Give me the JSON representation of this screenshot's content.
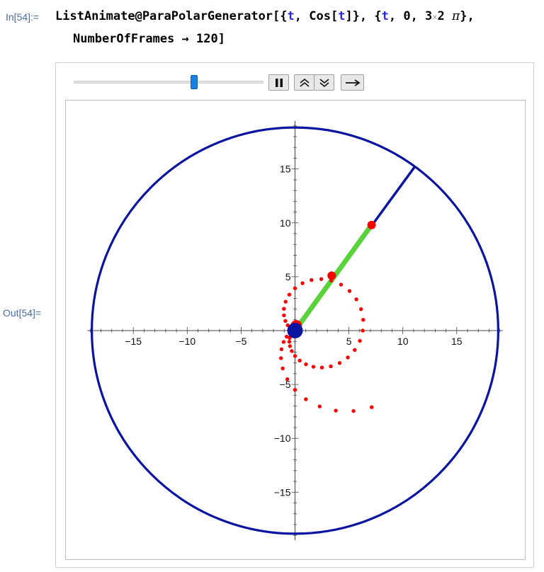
{
  "input": {
    "label": "In[54]:=",
    "line1": {
      "head": "ListAnimate@ParaPolarGenerator[{",
      "var1": "t",
      "mid1": ", Cos[",
      "var2": "t",
      "mid2": "]}, {",
      "var3": "t",
      "mid3": ", 0, 3",
      "times": "×",
      "two": "2",
      "pi": "π",
      "tail": "},"
    },
    "line2": "NumberOfFrames → 120]"
  },
  "output": {
    "label": "Out[54]="
  },
  "animation_controls": {
    "slider_value_fraction": 0.64,
    "buttons": [
      "pause-icon",
      "faster-icon",
      "slower-icon",
      "direction-icon"
    ]
  },
  "colors": {
    "circle": "#0a14a0",
    "radius_line": "#0a14a0",
    "green_segment": "#5ad23c",
    "points": "#ff0000",
    "origin_disk": "#0a14a0",
    "axes": "#444444"
  },
  "chart_data": {
    "type": "scatter",
    "xlim": [
      -19,
      19
    ],
    "ylim": [
      -19.2,
      19.2
    ],
    "x_ticks": [
      -15,
      -10,
      -5,
      5,
      10,
      15
    ],
    "y_ticks": [
      -15,
      -10,
      -5,
      5,
      10,
      15
    ],
    "x_tick_labels": [
      "−15",
      "−10",
      "−5",
      "5",
      "10",
      "15"
    ],
    "y_tick_labels": [
      "−15",
      "−10",
      "−5",
      "5",
      "10",
      "15"
    ],
    "circle_radius": 18.85,
    "current_t": 11.9,
    "radius_line_end": [
      11.1,
      15.2
    ],
    "green_segment": {
      "from": [
        0,
        0
      ],
      "to": [
        7.1,
        9.8
      ]
    },
    "highlight_points": [
      [
        7.1,
        9.8
      ],
      [
        3.4,
        5.1
      ]
    ],
    "grid": false
  }
}
